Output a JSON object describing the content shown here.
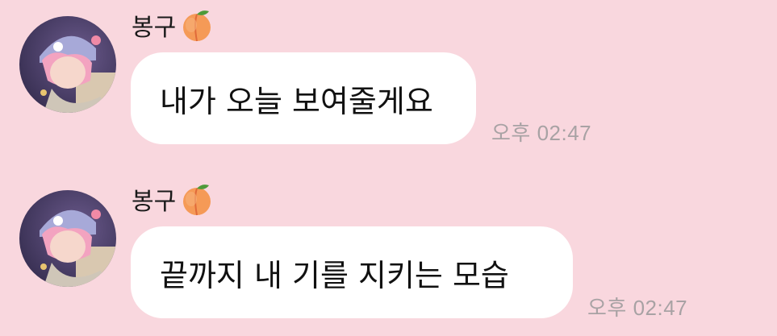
{
  "messages": [
    {
      "sender": "봉구",
      "sender_emoji_icon": "peach-icon",
      "text": "내가 오늘 보여줄게요",
      "time": "오후 02:47"
    },
    {
      "sender": "봉구",
      "sender_emoji_icon": "peach-icon",
      "text": "끝까지 내 기를 지키는 모습",
      "time": "오후 02:47"
    }
  ],
  "colors": {
    "background": "#f9d7de",
    "bubble": "#ffffff",
    "timestamp": "#a8a2a4"
  }
}
